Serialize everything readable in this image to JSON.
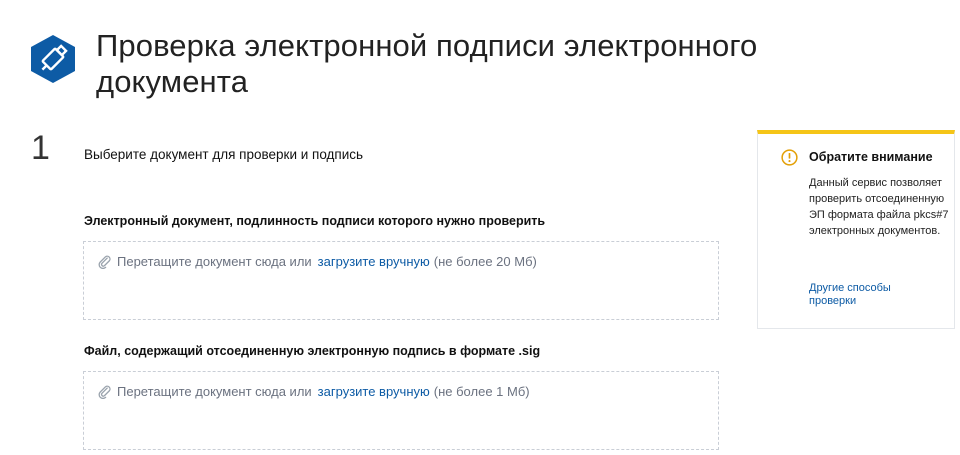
{
  "page": {
    "title": "Проверка электронной подписи электронного документа"
  },
  "step": {
    "number": "1",
    "title": "Выберите документ для проверки и подпись"
  },
  "fields": [
    {
      "label": "Электронный документ, подлинность подписи которого нужно проверить",
      "drop_text": "Перетащите документ сюда или",
      "upload_link": "загрузите вручную",
      "limit": "(не более 20 Мб)"
    },
    {
      "label": "Файл, содержащий отсоединенную электронную подпись в формате .sig",
      "drop_text": "Перетащите документ сюда или",
      "upload_link": "загрузите вручную",
      "limit": "(не более 1 Мб)"
    }
  ],
  "notice": {
    "title": "Обратите внимание",
    "body": "Данный сервис позволяет проверить отсоединенную ЭП формата файла pkcs#7 электронных документов.",
    "link": "Другие способы проверки"
  },
  "colors": {
    "brand": "#0d5ba5",
    "notice_accent": "#f5c518",
    "dropzone_border": "#c9ced6"
  },
  "icons": {
    "logo": "usb-token-icon",
    "attachment": "paperclip-icon",
    "notice": "warning-icon"
  }
}
